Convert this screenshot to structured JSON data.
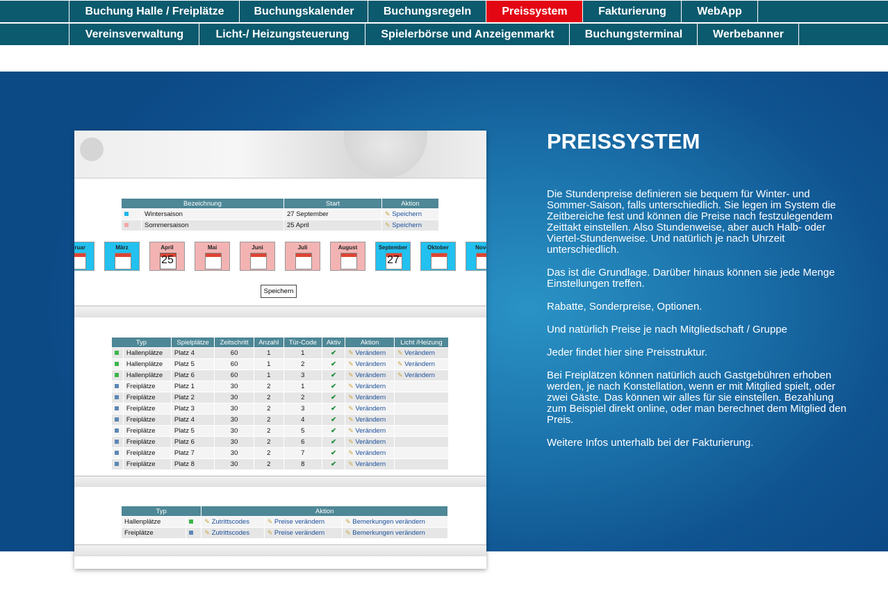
{
  "nav": {
    "row1": [
      {
        "label": "Buchung Halle / Freiplätze",
        "active": false
      },
      {
        "label": "Buchungskalender",
        "active": false
      },
      {
        "label": "Buchungsregeln",
        "active": false
      },
      {
        "label": "Preissystem",
        "active": true
      },
      {
        "label": "Fakturierung",
        "active": false
      },
      {
        "label": "WebApp",
        "active": false
      }
    ],
    "row2": [
      {
        "label": "Vereinsverwaltung"
      },
      {
        "label": "Licht-/ Heizungsteuerung"
      },
      {
        "label": "Spielerbörse und Anzeigenmarkt"
      },
      {
        "label": "Buchungsterminal"
      },
      {
        "label": "Werbebanner"
      }
    ]
  },
  "colors": {
    "nav_bg": "#0c5a6e",
    "active": "#e30613",
    "hero": "#1a6fa8"
  },
  "hero": {
    "title": "PREISSYSTEM",
    "paragraphs": [
      "Die Stundenpreise definieren sie bequem für Winter- und Sommer-Saison, falls unterschiedlich. Sie legen im System die Zeitbereiche fest und können die Preise nach festzulegendem Zeittakt einstellen. Also Stundenweise, aber auch Halb- oder Viertel-Stundenweise. Und natürlich je nach Uhrzeit unterschiedlich.",
      "Das ist die Grundlage. Darüber hinaus können sie jede Menge Einstellungen treffen.",
      "Rabatte, Sonderpreise, Optionen.",
      "Und natürlich Preise je nach Mitgliedschaft / Gruppe",
      "Jeder findet hier sine Preisstruktur.",
      "Bei Freiplätzen können natürlich auch Gastgebühren erhoben werden, je nach Konstellation, wenn er mit Mitglied spielt, oder zwei Gäste. Das können wir alles für sie einstellen. Bezahlung zum Beispiel direkt online, oder man berechnet dem Mitglied den Preis.",
      "Weitere Infos unterhalb bei der Fakturierung."
    ]
  },
  "shot": {
    "season_headers": [
      "Bezeichnung",
      "Start",
      "Aktion"
    ],
    "seasons": [
      {
        "name": "Wintersaison",
        "start": "27 September",
        "action": "Speichern",
        "color": "#1fb6e8"
      },
      {
        "name": "Sommersaison",
        "start": "25 April",
        "action": "Speichern",
        "color": "#f2a8a8"
      }
    ],
    "months": [
      {
        "name": "ebruar",
        "color": "#22c1f0",
        "day": ""
      },
      {
        "name": "März",
        "color": "#22c1f0",
        "day": ""
      },
      {
        "name": "April",
        "color": "#f3b3b3",
        "day": "25"
      },
      {
        "name": "Mai",
        "color": "#f3b3b3",
        "day": ""
      },
      {
        "name": "Juni",
        "color": "#f3b3b3",
        "day": ""
      },
      {
        "name": "Juli",
        "color": "#f3b3b3",
        "day": ""
      },
      {
        "name": "August",
        "color": "#f3b3b3",
        "day": ""
      },
      {
        "name": "September",
        "color": "#22c1f0",
        "day": "27"
      },
      {
        "name": "Oktober",
        "color": "#22c1f0",
        "day": ""
      },
      {
        "name": "Nover",
        "color": "#22c1f0",
        "day": ""
      }
    ],
    "save_label": "Speichern",
    "court_headers": [
      "Typ",
      "Spielplätze",
      "Zeitschritt",
      "Anzahl",
      "Tür-Code",
      "Aktiv",
      "Aktion",
      "Licht /Heizung"
    ],
    "courts": [
      {
        "typ": "Hallenplätze",
        "platz": "Platz 4",
        "zeit": "60",
        "anzahl": "1",
        "code": "1",
        "aktion": "Verändern",
        "licht": "Verändern",
        "color": "#3cb54a"
      },
      {
        "typ": "Hallenplätze",
        "platz": "Platz 5",
        "zeit": "60",
        "anzahl": "1",
        "code": "2",
        "aktion": "Verändern",
        "licht": "Verändern",
        "color": "#3cb54a"
      },
      {
        "typ": "Hallenplätze",
        "platz": "Platz 6",
        "zeit": "60",
        "anzahl": "1",
        "code": "3",
        "aktion": "Verändern",
        "licht": "Verändern",
        "color": "#3cb54a"
      },
      {
        "typ": "Freiplätze",
        "platz": "Platz 1",
        "zeit": "30",
        "anzahl": "2",
        "code": "1",
        "aktion": "Verändern",
        "licht": "",
        "color": "#5c87b5"
      },
      {
        "typ": "Freiplätze",
        "platz": "Platz 2",
        "zeit": "30",
        "anzahl": "2",
        "code": "2",
        "aktion": "Verändern",
        "licht": "",
        "color": "#5c87b5"
      },
      {
        "typ": "Freiplätze",
        "platz": "Platz 3",
        "zeit": "30",
        "anzahl": "2",
        "code": "3",
        "aktion": "Verändern",
        "licht": "",
        "color": "#5c87b5"
      },
      {
        "typ": "Freiplätze",
        "platz": "Platz 4",
        "zeit": "30",
        "anzahl": "2",
        "code": "4",
        "aktion": "Verändern",
        "licht": "",
        "color": "#5c87b5"
      },
      {
        "typ": "Freiplätze",
        "platz": "Platz 5",
        "zeit": "30",
        "anzahl": "2",
        "code": "5",
        "aktion": "Verändern",
        "licht": "",
        "color": "#5c87b5"
      },
      {
        "typ": "Freiplätze",
        "platz": "Platz 6",
        "zeit": "30",
        "anzahl": "2",
        "code": "6",
        "aktion": "Verändern",
        "licht": "",
        "color": "#5c87b5"
      },
      {
        "typ": "Freiplätze",
        "platz": "Platz 7",
        "zeit": "30",
        "anzahl": "2",
        "code": "7",
        "aktion": "Verändern",
        "licht": "",
        "color": "#5c87b5"
      },
      {
        "typ": "Freiplätze",
        "platz": "Platz 8",
        "zeit": "30",
        "anzahl": "2",
        "code": "8",
        "aktion": "Verändern",
        "licht": "",
        "color": "#5c87b5"
      }
    ],
    "type_headers": [
      "Typ",
      "Aktion"
    ],
    "types": [
      {
        "typ": "Hallenplätze",
        "color": "#3cb54a",
        "a1": "Zutrittscodes",
        "a2": "Preise verändern",
        "a3": "Bemerkungen verändern"
      },
      {
        "typ": "Freiplätze",
        "color": "#5c87b5",
        "a1": "Zutrittscodes",
        "a2": "Preise verändern",
        "a3": "Bemerkungen verändern"
      }
    ]
  }
}
